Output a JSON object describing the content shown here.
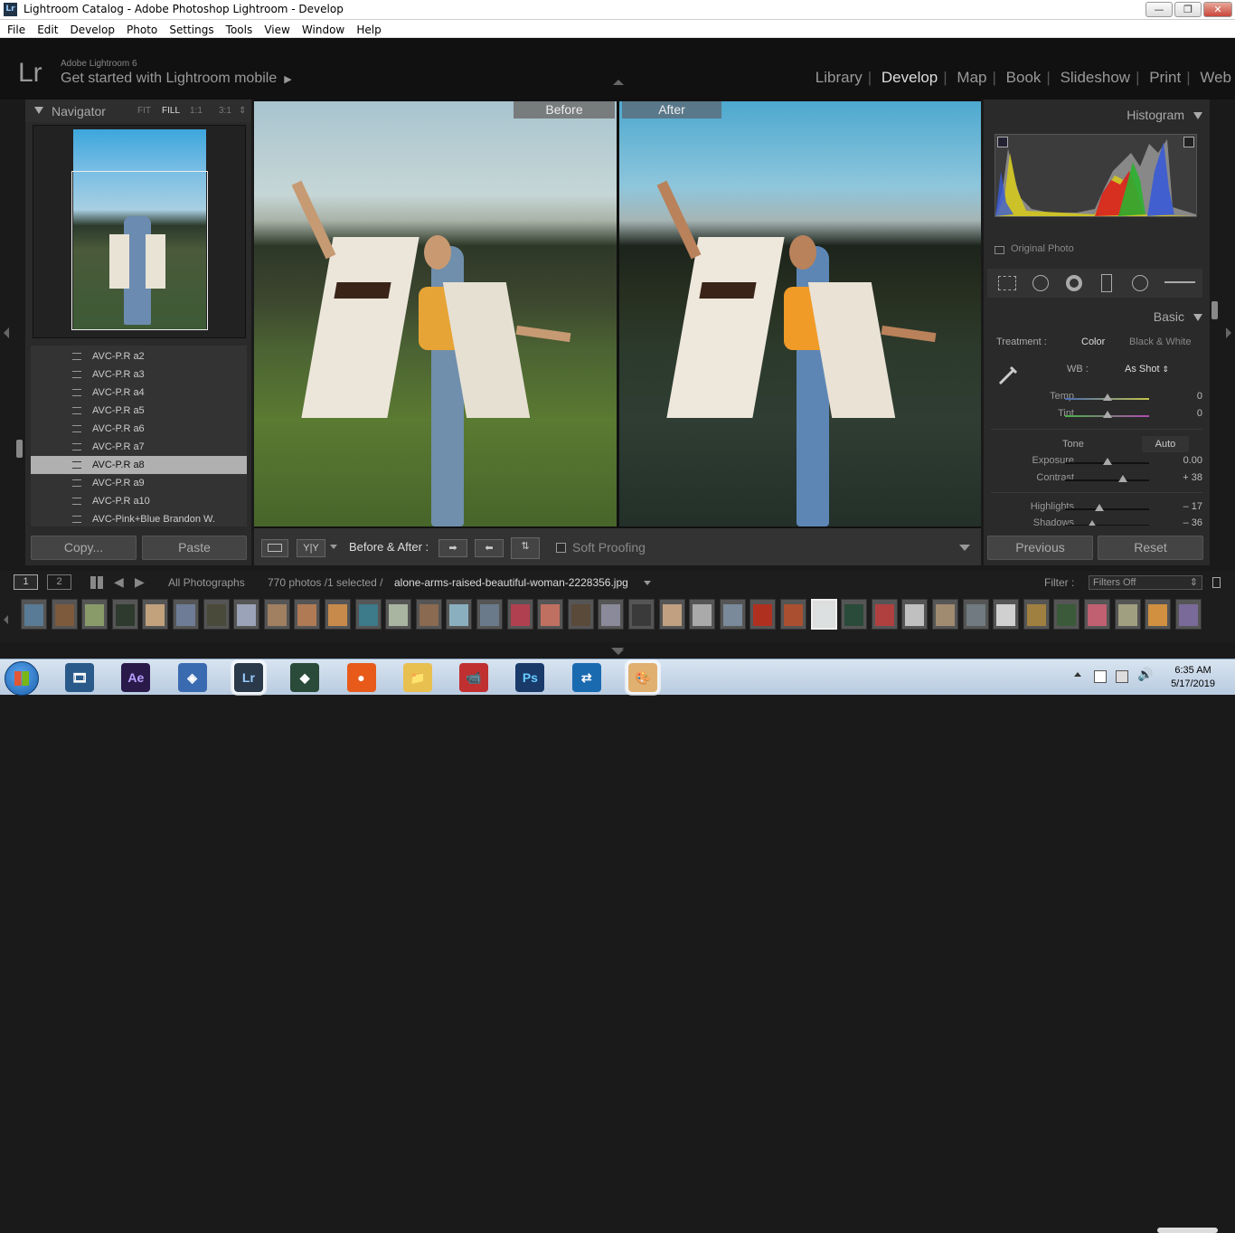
{
  "window": {
    "title": "Lightroom Catalog - Adobe Photoshop Lightroom - Develop",
    "minimize_label": "—",
    "restore_label": "❐",
    "close_label": "✕"
  },
  "menu": [
    "File",
    "Edit",
    "Develop",
    "Photo",
    "Settings",
    "Tools",
    "View",
    "Window",
    "Help"
  ],
  "lrheader": {
    "logo": "Lr",
    "product": "Adobe Lightroom 6",
    "mobile_text": "Get started with Lightroom mobile",
    "modules": [
      "Library",
      "Develop",
      "Map",
      "Book",
      "Slideshow",
      "Print",
      "Web"
    ],
    "active_module": "Develop"
  },
  "navigator": {
    "title": "Navigator",
    "zoom": [
      "FIT",
      "FILL",
      "1:1",
      "3:1"
    ]
  },
  "presets": [
    {
      "label": "AVC-P.R a2"
    },
    {
      "label": "AVC-P.R a3"
    },
    {
      "label": "AVC-P.R a4"
    },
    {
      "label": "AVC-P.R a5"
    },
    {
      "label": "AVC-P.R a6"
    },
    {
      "label": "AVC-P.R a7"
    },
    {
      "label": "AVC-P.R a8",
      "selected": true
    },
    {
      "label": "AVC-P.R a9"
    },
    {
      "label": "AVC-P.R a10"
    },
    {
      "label": "AVC-Pink+Blue Brandon W."
    }
  ],
  "left_buttons": {
    "copy": "Copy...",
    "paste": "Paste"
  },
  "view": {
    "before_label": "Before",
    "after_label": "After"
  },
  "toolbar": {
    "yy_label": "Y|Y",
    "mode_label": "Before & After :",
    "soft_proofing": "Soft Proofing"
  },
  "histogram": {
    "title": "Histogram",
    "original_photo": "Original Photo"
  },
  "basic": {
    "title": "Basic",
    "treatment_label": "Treatment :",
    "color_option": "Color",
    "bw_option": "Black & White",
    "wb_label": "WB :",
    "wb_value": "As Shot",
    "tone_label": "Tone",
    "auto_label": "Auto",
    "sliders": [
      {
        "label": "Temp",
        "value": "0",
        "position": 0.5
      },
      {
        "label": "Tint",
        "value": "0",
        "position": 0.5
      },
      {
        "label": "Exposure",
        "value": "0.00",
        "position": 0.5
      },
      {
        "label": "Contrast",
        "value": "+ 38",
        "position": 0.69
      },
      {
        "label": "Highlights",
        "value": "– 17",
        "position": 0.41
      },
      {
        "label": "Shadows",
        "value": "– 36",
        "position": 0.32
      }
    ]
  },
  "right_buttons": {
    "previous": "Previous",
    "reset": "Reset"
  },
  "filmstrip_header": {
    "view1": "1",
    "view2": "2",
    "source": "All Photographs",
    "count": "770 photos /1 selected /",
    "filename": "alone-arms-raised-beautiful-woman-2228356.jpg",
    "filter_label": "Filter :",
    "filter_value": "Filters Off"
  },
  "taskbar": {
    "time": "6:35 AM",
    "date": "5/17/2019",
    "apps": [
      {
        "name": "movie-maker",
        "glyph": "🎞"
      },
      {
        "name": "after-effects",
        "glyph": "Ae"
      },
      {
        "name": "app-generic",
        "glyph": "◈"
      },
      {
        "name": "lightroom",
        "glyph": "Lr"
      },
      {
        "name": "filmora",
        "glyph": "◆"
      },
      {
        "name": "firefox",
        "glyph": "●"
      },
      {
        "name": "file-explorer",
        "glyph": "📁"
      },
      {
        "name": "camera-app",
        "glyph": "📹"
      },
      {
        "name": "photoshop",
        "glyph": "Ps"
      },
      {
        "name": "teamviewer",
        "glyph": "⇄"
      },
      {
        "name": "paint",
        "glyph": "🎨"
      }
    ]
  }
}
